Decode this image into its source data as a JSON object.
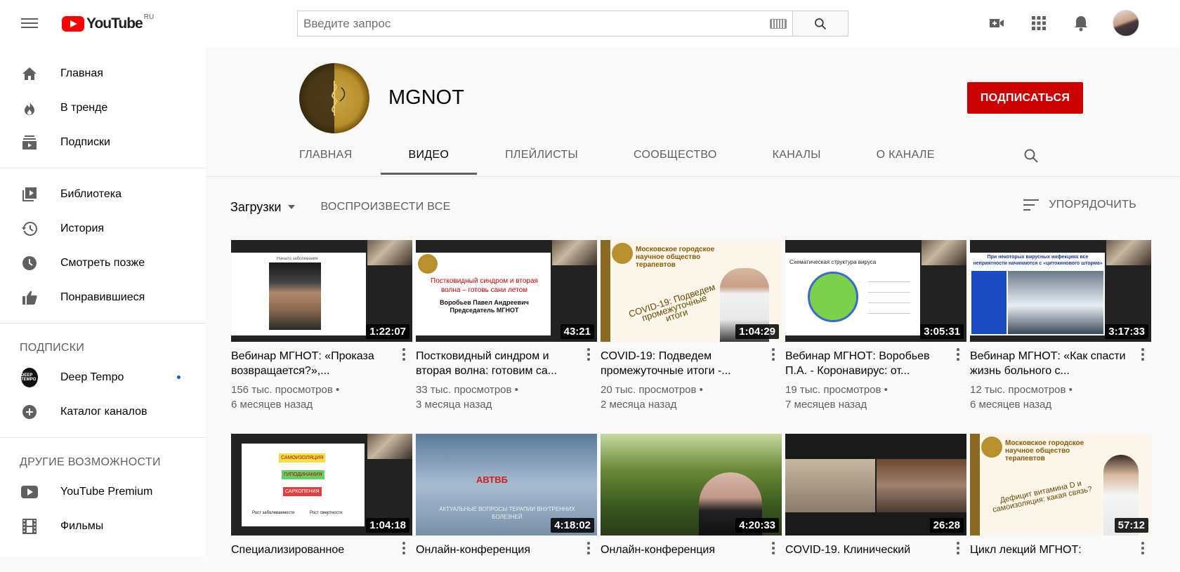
{
  "topbar": {
    "logo_text": "YouTube",
    "logo_region": "RU",
    "search_placeholder": "Введите запрос"
  },
  "sidebar": {
    "main": [
      {
        "label": "Главная",
        "icon": "home-icon"
      },
      {
        "label": "В тренде",
        "icon": "fire-icon"
      },
      {
        "label": "Подписки",
        "icon": "subscriptions-icon"
      }
    ],
    "library": [
      {
        "label": "Библиотека",
        "icon": "library-icon"
      },
      {
        "label": "История",
        "icon": "history-icon"
      },
      {
        "label": "Смотреть позже",
        "icon": "clock-icon"
      },
      {
        "label": "Понравившиеся",
        "icon": "thumbs-up-icon"
      }
    ],
    "subscriptions_heading": "ПОДПИСКИ",
    "subscriptions": [
      {
        "label": "Deep Tempo",
        "avatar_text": "DEEP TEMPO"
      },
      {
        "label": "Каталог каналов",
        "icon": "add-circle-icon"
      }
    ],
    "more_heading": "ДРУГИЕ ВОЗМОЖНОСТИ",
    "more": [
      {
        "label": "YouTube Premium",
        "icon": "youtube-icon"
      },
      {
        "label": "Фильмы",
        "icon": "film-icon"
      }
    ]
  },
  "channel": {
    "name": "MGNOT",
    "subscribe_label": "ПОДПИСАТЬСЯ",
    "tabs": [
      "ГЛАВНАЯ",
      "ВИДЕО",
      "ПЛЕЙЛИСТЫ",
      "СООБЩЕСТВО",
      "КАНАЛЫ",
      "О КАНАЛЕ"
    ],
    "active_tab": "ВИДЕО"
  },
  "toolbar": {
    "uploads_label": "Загрузки",
    "play_all_label": "ВОСПРОИЗВЕСТИ ВСЕ",
    "sort_label": "УПОРЯДОЧИТЬ"
  },
  "videos": [
    {
      "title": "Вебинар МГНОТ: «Проказа возвращается?»,...",
      "views": "156 тыс. просмотров •",
      "age": "6 месяцев назад",
      "duration": "1:22:07"
    },
    {
      "title": "Постковидный синдром и вторая волна: готовим са...",
      "views": "33 тыс. просмотров •",
      "age": "3 месяца назад",
      "duration": "43:21"
    },
    {
      "title": "COVID-19: Подведем промежуточные итоги -...",
      "views": "20 тыс. просмотров •",
      "age": "2 месяца назад",
      "duration": "1:04:29"
    },
    {
      "title": "Вебинар МГНОТ: Воробьев П.А. - Коронавирус: от...",
      "views": "19 тыс. просмотров •",
      "age": "7 месяцев назад",
      "duration": "3:05:31"
    },
    {
      "title": "Вебинар МГНОТ: «Как спасти жизнь больного с...",
      "views": "12 тыс. просмотров •",
      "age": "6 месяцев назад",
      "duration": "3:17:33"
    },
    {
      "title": "Специализированное",
      "views": "",
      "age": "",
      "duration": "1:04:18"
    },
    {
      "title": "Онлайн-конференция",
      "views": "",
      "age": "",
      "duration": "4:18:02"
    },
    {
      "title": "Онлайн-конференция",
      "views": "",
      "age": "",
      "duration": "4:20:33"
    },
    {
      "title": "COVID-19. Клинический",
      "views": "",
      "age": "",
      "duration": "26:28"
    },
    {
      "title": "Цикл лекций МГНОТ:",
      "views": "",
      "age": "",
      "duration": "57:12"
    }
  ],
  "thumb_text": {
    "v1_caption": "Начало заболевания",
    "v2_line1": "Постковидный синдром и вторая",
    "v2_line2": "волна – готовь сани летом",
    "v2_line3": "Воробьев Павел Андреевич",
    "v2_line4": "Председатель МГНОТ",
    "v3_header": "Московское городское научное общество терапевтов",
    "v3_text": "COVID-19: Подведем промежуточные итоги",
    "v4_header": "Схематическая структура вируса",
    "v5_header": "При некоторых вирусных инфекциях все неприятности начинаются с «цитокинового шторма»",
    "v6_box1": "САМОИЗОЛЯЦИЯ",
    "v6_box2": "ГИПОДИНАМИЯ",
    "v6_box3": "САРКОПЕНИЯ",
    "v6_left": "Рост заболеваемости",
    "v6_right": "Рост смертности",
    "v7_logo": "АВТВБ",
    "v7_text": "АКТУАЛЬНЫЕ ВОПРОСЫ ТЕРАПИИ ВНУТРЕННИХ БОЛЕЗНЕЙ",
    "v10_header": "Московское городское научное общество терапевтов",
    "v10_text": "Дефицит витамина D и самоизоляция: какая связь?"
  }
}
